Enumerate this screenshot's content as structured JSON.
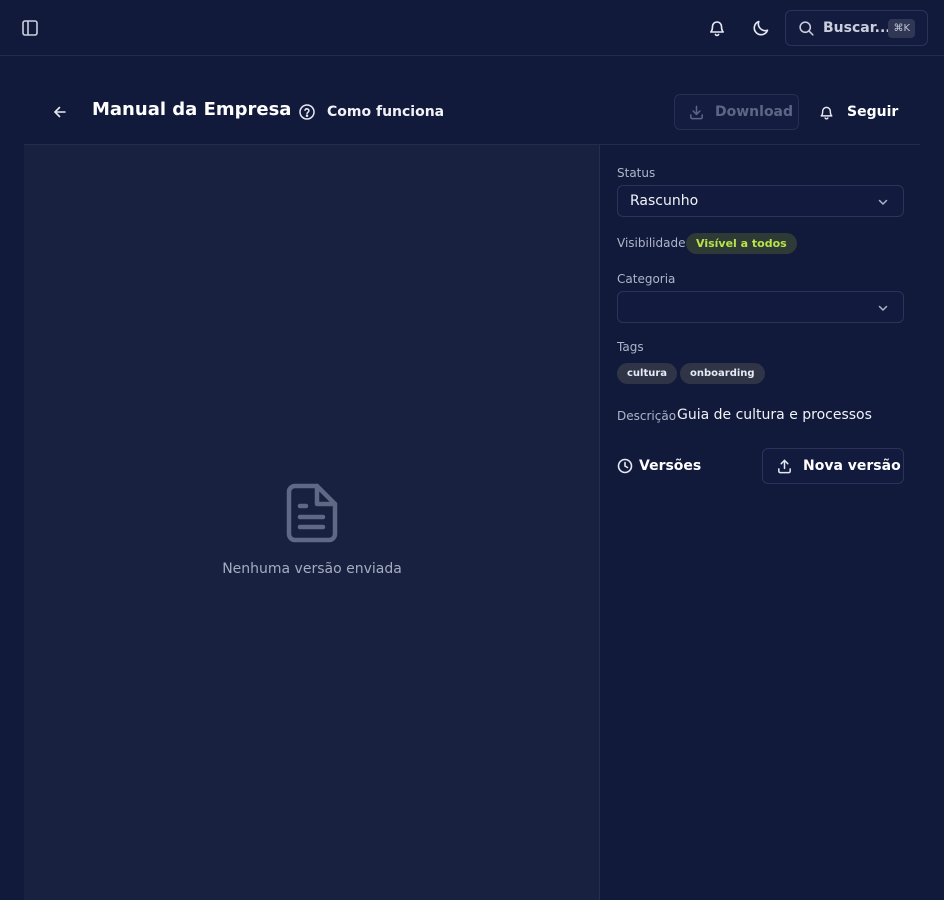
{
  "topbar": {
    "search_label": "Buscar...",
    "search_shortcut": "⌘K",
    "icons": [
      "sidebar-toggle-icon",
      "bell-icon",
      "moon-icon",
      "search-icon"
    ]
  },
  "header": {
    "title": "Manual da Empresa",
    "how_it_works_label": "Como funciona",
    "download_label": "Download",
    "follow_label": "Seguir"
  },
  "preview": {
    "empty_text": "Nenhuma versão enviada"
  },
  "details": {
    "status_label": "Status",
    "status_value": "Rascunho",
    "visibility_label": "Visibilidade",
    "visibility_value": "Visível a todos",
    "category_label": "Categoria",
    "category_value": "",
    "tags_label": "Tags",
    "tags": [
      "cultura",
      "onboarding"
    ],
    "description_label": "Descrição",
    "description_value": "Guia de cultura e processos"
  },
  "versions": {
    "title": "Versões",
    "new_version_label": "Nova versão"
  },
  "colors": {
    "background": "#111a3b",
    "preview_background": "#182140",
    "visibility_badge_text": "#b8e34a",
    "visibility_badge_bg": "#2e3a36",
    "tag_bg": "#2f3446"
  }
}
